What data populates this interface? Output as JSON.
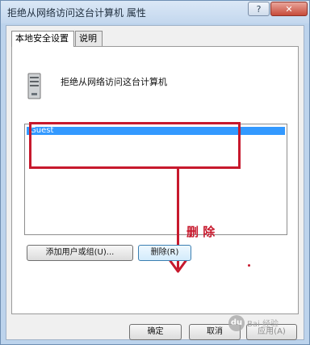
{
  "window": {
    "title": "拒绝从网络访问这台计算机 属性",
    "help": "?",
    "close": "✕"
  },
  "tabs": [
    "本地安全设置",
    "说明"
  ],
  "policy": {
    "title": "拒绝从网络访问这台计算机"
  },
  "list": {
    "items": [
      "Guest"
    ]
  },
  "annotation": {
    "delete_label": "删 除",
    "color": "#c7192d"
  },
  "buttons": {
    "add": "添加用户或组(U)...",
    "remove": "删除(R)",
    "ok": "确定",
    "cancel": "取消",
    "apply": "应用(A)"
  },
  "watermark": {
    "text": "Bai 经验"
  }
}
